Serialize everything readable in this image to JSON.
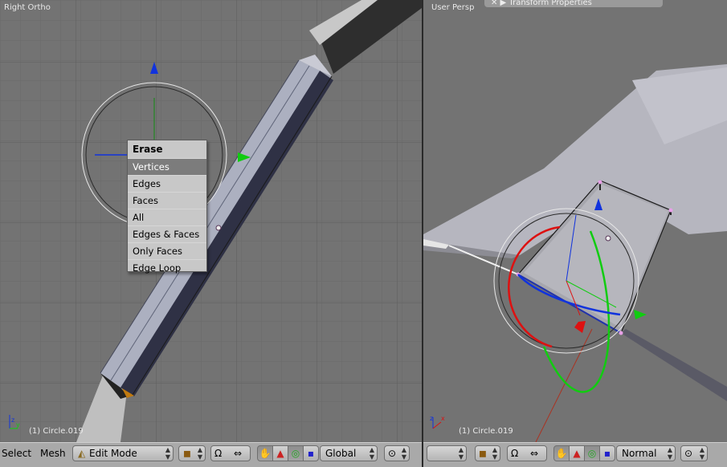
{
  "left_viewport": {
    "title": "Right Ortho",
    "object_label": "(1) Circle.019"
  },
  "right_viewport": {
    "title": "User Persp",
    "object_label": "(1) Circle.019",
    "panel_label": "Transform Properties"
  },
  "erase_menu": {
    "title": "Erase",
    "items": [
      "Vertices",
      "Edges",
      "Faces",
      "All",
      "Edges & Faces",
      "Only Faces",
      "Edge Loop"
    ],
    "highlighted": "Vertices"
  },
  "header_left": {
    "select_label": "Select",
    "mesh_label": "Mesh",
    "mode_value": "Edit Mode",
    "orientation_value": "Global"
  },
  "header_right": {
    "orientation_value": "Normal"
  },
  "colors": {
    "viewport_bg": "#737373",
    "header_bg": "#a9a9a9",
    "menu_bg": "#c8c8c8",
    "menu_highlight": "#7c7c7c",
    "axis_x": "#dd1111",
    "axis_y": "#11cc11",
    "axis_z": "#1133dd"
  },
  "icons": [
    "axis-gizmo-icon",
    "object-type-icon",
    "snap-magnet-icon",
    "hand-manipulator-icon",
    "translate-arrow-icon",
    "rotate-icon",
    "scale-icon",
    "pivot-icon"
  ]
}
